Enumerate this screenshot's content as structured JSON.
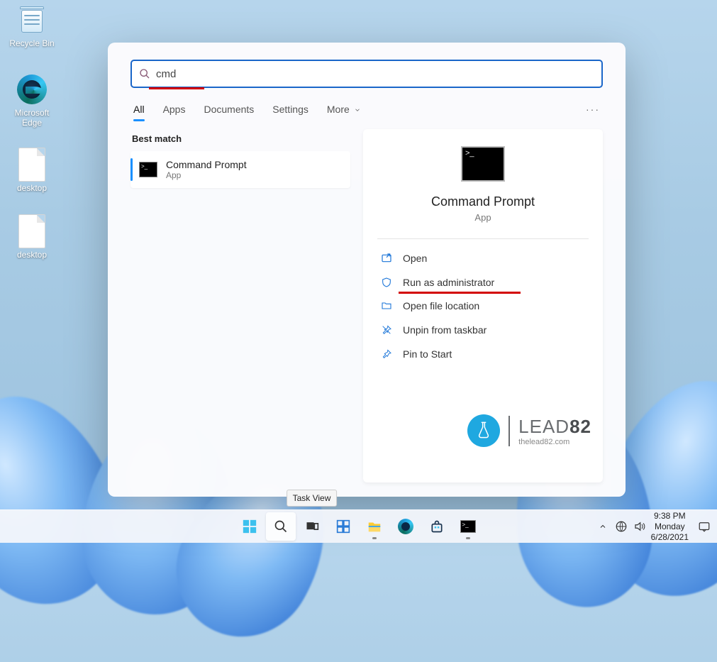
{
  "desktop": {
    "icons": [
      {
        "name": "recycle-bin",
        "label": "Recycle Bin"
      },
      {
        "name": "ms-edge",
        "label": "Microsoft\nEdge"
      },
      {
        "name": "desktop-file-1",
        "label": "desktop"
      },
      {
        "name": "desktop-file-2",
        "label": "desktop"
      }
    ]
  },
  "search_panel": {
    "query": "cmd",
    "tabs": [
      "All",
      "Apps",
      "Documents",
      "Settings",
      "More"
    ],
    "best_match_label": "Best match",
    "result": {
      "title": "Command Prompt",
      "subtitle": "App"
    },
    "details": {
      "title": "Command Prompt",
      "subtitle": "App",
      "actions": [
        {
          "icon": "open",
          "label": "Open"
        },
        {
          "icon": "shield",
          "label": "Run as administrator"
        },
        {
          "icon": "folder",
          "label": "Open file location"
        },
        {
          "icon": "unpin",
          "label": "Unpin from taskbar"
        },
        {
          "icon": "pin",
          "label": "Pin to Start"
        }
      ]
    }
  },
  "taskbar": {
    "tooltip": "Task View",
    "items": [
      "start",
      "search",
      "taskview",
      "widgets",
      "explorer",
      "edge",
      "store",
      "terminal"
    ]
  },
  "systray": {
    "time": "9:38 PM",
    "day": "Monday",
    "date": "6/28/2021"
  },
  "watermark": {
    "brand": "LEAD",
    "num": "82",
    "url": "thelead82.com"
  }
}
